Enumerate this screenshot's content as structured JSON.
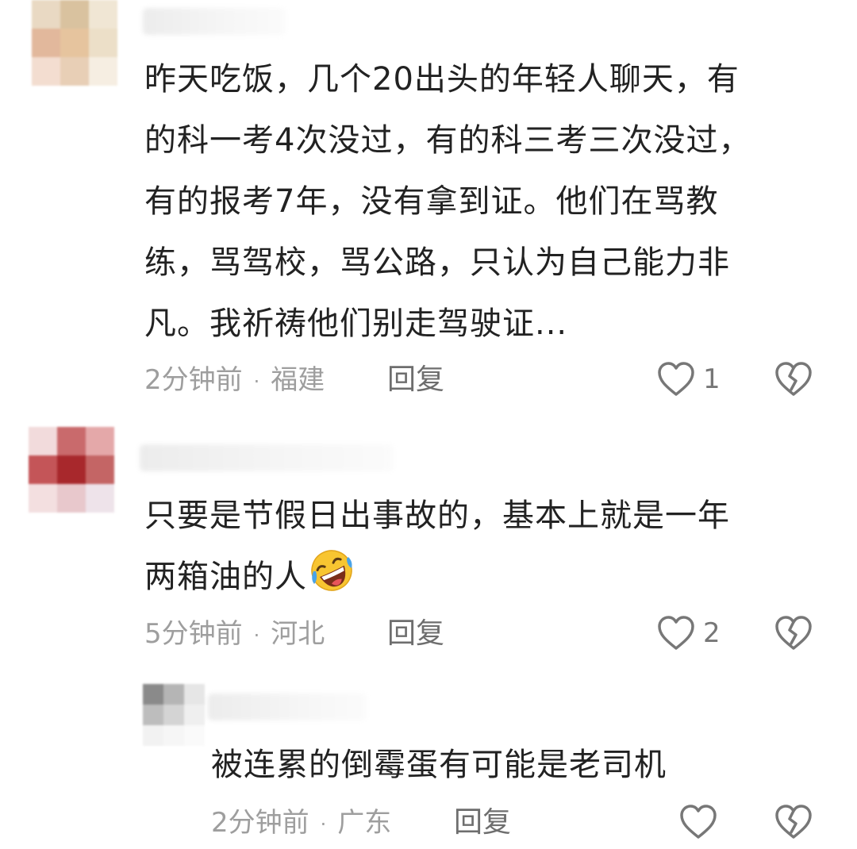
{
  "colors": {
    "text": "#222222",
    "meta": "#9e9e9e",
    "icon": "#777777",
    "background": "#ffffff"
  },
  "comments": [
    {
      "text_lines": [
        "昨天吃饭，几个20出头的年轻人聊天，有",
        "的科一考4次没过，有的科三考三次没过，",
        "有的报考7年，没有拿到证。他们在骂教",
        "练，骂驾校，骂公路，只认为自己能力非",
        "凡。我祈祷他们别走驾驶证..."
      ],
      "time": "2分钟前",
      "location": "福建",
      "reply_label": "回复",
      "likes": "1"
    },
    {
      "text_lines": [
        "只要是节假日出事故的，基本上就是一年",
        "两箱油的人"
      ],
      "emoji": "rolling-on-floor-laughing-emoji",
      "time": "5分钟前",
      "location": "河北",
      "reply_label": "回复",
      "likes": "2"
    },
    {
      "text_lines": [
        "被连累的倒霉蛋有可能是老司机"
      ],
      "time": "2分钟前",
      "location": "广东",
      "reply_label": "回复",
      "likes": ""
    }
  ],
  "separator": "·"
}
